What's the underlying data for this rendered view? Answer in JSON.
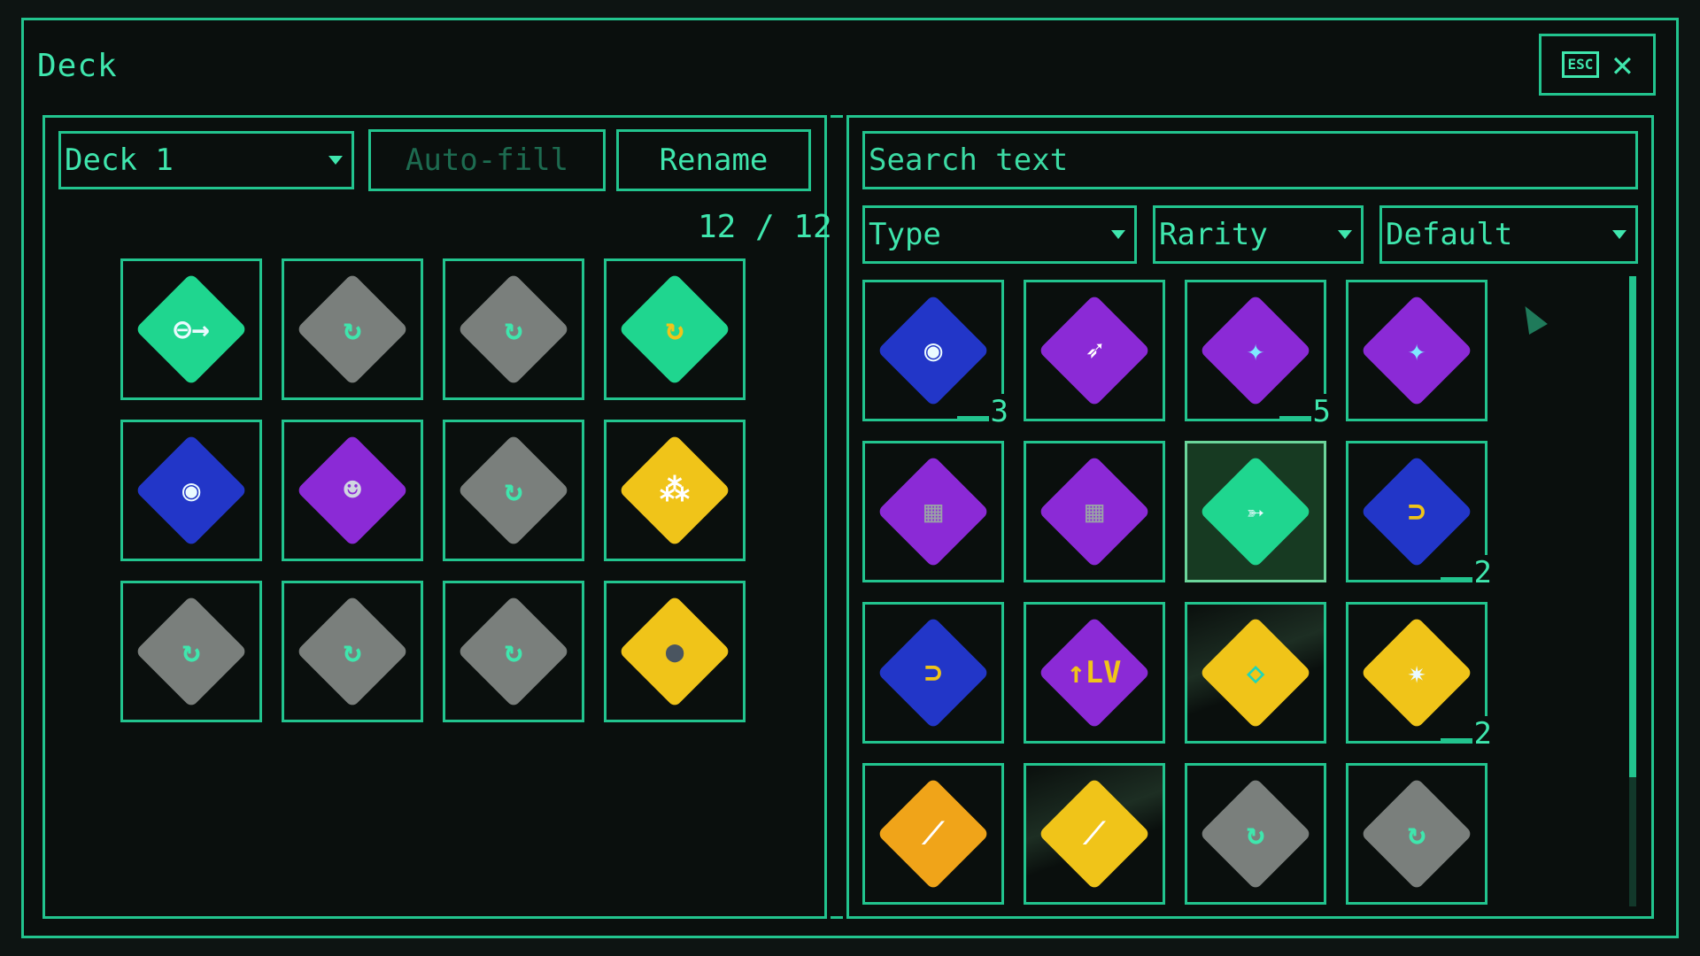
{
  "window": {
    "title": "Deck"
  },
  "close_button": {
    "key": "ESC",
    "symbol": "✕"
  },
  "left": {
    "deck_select": "Deck 1",
    "autofill_label": "Auto-fill",
    "rename_label": "Rename",
    "counter": "12 / 12",
    "slots": [
      {
        "icon": "swap-arrow-icon",
        "color": "#1fd68f",
        "glyph": "⊖→",
        "glyph_color": "#eafaff"
      },
      {
        "icon": "refresh-icon",
        "color": "#7a7f7c",
        "glyph": "↻",
        "glyph_color": "#3fe6ad"
      },
      {
        "icon": "refresh-icon",
        "color": "#7a7f7c",
        "glyph": "↻",
        "glyph_color": "#3fe6ad"
      },
      {
        "icon": "rock-refresh-icon",
        "color": "#1fd68f",
        "glyph": "↻",
        "glyph_color": "#f0c419"
      },
      {
        "icon": "bag-icon",
        "color": "#2236c8",
        "glyph": "◉",
        "glyph_color": "#eafaff"
      },
      {
        "icon": "robot-icon",
        "color": "#8b2ad6",
        "glyph": "☻",
        "glyph_color": "#cfd6e0"
      },
      {
        "icon": "refresh-icon",
        "color": "#7a7f7c",
        "glyph": "↻",
        "glyph_color": "#3fe6ad"
      },
      {
        "icon": "grid-icon",
        "color": "#f0c419",
        "glyph": "⁂",
        "glyph_color": "#ffffff"
      },
      {
        "icon": "refresh-icon",
        "color": "#7a7f7c",
        "glyph": "↻",
        "glyph_color": "#3fe6ad"
      },
      {
        "icon": "refresh-icon",
        "color": "#7a7f7c",
        "glyph": "↻",
        "glyph_color": "#3fe6ad"
      },
      {
        "icon": "refresh-icon",
        "color": "#7a7f7c",
        "glyph": "↻",
        "glyph_color": "#3fe6ad"
      },
      {
        "icon": "boulder-icon",
        "color": "#f0c419",
        "glyph": "●",
        "glyph_color": "#4a5560"
      }
    ]
  },
  "right": {
    "search_placeholder": "Search text",
    "filters": {
      "type": "Type",
      "rarity": "Rarity",
      "sort": "Default"
    },
    "cards": [
      {
        "icon": "bag-icon",
        "color": "#2236c8",
        "glyph": "◉",
        "glyph_color": "#eafaff",
        "count": "3"
      },
      {
        "icon": "rocket-icon",
        "color": "#8b2ad6",
        "glyph": "➶",
        "glyph_color": "#ffffff",
        "count": ""
      },
      {
        "icon": "shatter-icon",
        "color": "#8b2ad6",
        "glyph": "✦",
        "glyph_color": "#7fe8ff",
        "count": "5"
      },
      {
        "icon": "shatter-icon",
        "color": "#8b2ad6",
        "glyph": "✦",
        "glyph_color": "#7fe8ff",
        "count": ""
      },
      {
        "icon": "laser-block-icon",
        "color": "#8b2ad6",
        "glyph": "▦",
        "glyph_color": "#9aa0a8",
        "count": ""
      },
      {
        "icon": "laser-block-icon",
        "color": "#8b2ad6",
        "glyph": "▦",
        "glyph_color": "#9aa0a8",
        "count": ""
      },
      {
        "icon": "bow-icon",
        "color": "#1fd68f",
        "glyph": "➳",
        "glyph_color": "#eafaff",
        "count": ""
      },
      {
        "icon": "portal-icon",
        "color": "#2236c8",
        "glyph": "⊃",
        "glyph_color": "#f0c419",
        "count": "2"
      },
      {
        "icon": "portal-icon",
        "color": "#2236c8",
        "glyph": "⊃",
        "glyph_color": "#f0c419",
        "count": ""
      },
      {
        "icon": "level-up-icon",
        "color": "#8b2ad6",
        "glyph": "↑LV",
        "glyph_color": "#f0c419",
        "count": ""
      },
      {
        "icon": "chip-icon",
        "color": "#f0c419",
        "glyph": "◇",
        "glyph_color": "#1fd6b8",
        "count": ""
      },
      {
        "icon": "burst-icon",
        "color": "#f0c419",
        "glyph": "✷",
        "glyph_color": "#eafaff",
        "count": "2"
      },
      {
        "icon": "fire-slash-icon",
        "color": "#f0a419",
        "glyph": "⟋",
        "glyph_color": "#ffffff",
        "count": ""
      },
      {
        "icon": "fire-slash-icon",
        "color": "#f0c419",
        "glyph": "⟋",
        "glyph_color": "#ffffff",
        "count": ""
      },
      {
        "icon": "refresh-icon",
        "color": "#7a7f7c",
        "glyph": "↻",
        "glyph_color": "#3fe6ad",
        "count": ""
      },
      {
        "icon": "refresh-icon",
        "color": "#7a7f7c",
        "glyph": "↻",
        "glyph_color": "#3fe6ad",
        "count": ""
      }
    ]
  }
}
